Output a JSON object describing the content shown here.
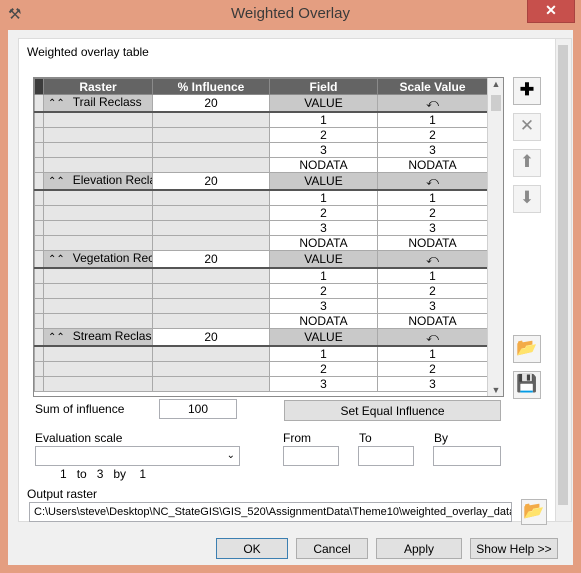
{
  "window": {
    "title": "Weighted Overlay",
    "close_label": "✕"
  },
  "table_label": "Weighted overlay table",
  "columns": [
    "Raster",
    "% Influence",
    "Field",
    "Scale Value"
  ],
  "groups": [
    {
      "raster": "Trail Reclass",
      "influence": "20",
      "field": "VALUE",
      "rows": [
        {
          "field": "1",
          "scale": "1"
        },
        {
          "field": "2",
          "scale": "2"
        },
        {
          "field": "3",
          "scale": "3"
        },
        {
          "field": "NODATA",
          "scale": "NODATA"
        }
      ]
    },
    {
      "raster": "Elevation Reclass",
      "influence": "20",
      "field": "VALUE",
      "rows": [
        {
          "field": "1",
          "scale": "1"
        },
        {
          "field": "2",
          "scale": "2"
        },
        {
          "field": "3",
          "scale": "3"
        },
        {
          "field": "NODATA",
          "scale": "NODATA"
        }
      ]
    },
    {
      "raster": "Vegetation Reclass",
      "influence": "20",
      "field": "VALUE",
      "rows": [
        {
          "field": "1",
          "scale": "1"
        },
        {
          "field": "2",
          "scale": "2"
        },
        {
          "field": "3",
          "scale": "3"
        },
        {
          "field": "NODATA",
          "scale": "NODATA"
        }
      ]
    },
    {
      "raster": "Stream Reclass",
      "influence": "20",
      "field": "VALUE",
      "rows": [
        {
          "field": "1",
          "scale": "1"
        },
        {
          "field": "2",
          "scale": "2"
        },
        {
          "field": "3",
          "scale": "3"
        }
      ]
    }
  ],
  "sum_label": "Sum of influence",
  "sum_value": "100",
  "set_equal_label": "Set Equal Influence",
  "eval_label": "Evaluation scale",
  "eval_value": "1   to   3   by    1",
  "from_label": "From",
  "to_label": "To",
  "by_label": "By",
  "output_label": "Output raster",
  "output_path": "C:\\Users\\steve\\Desktop\\NC_StateGIS\\GIS_520\\AssignmentData\\Theme10\\weighted_overlay_data",
  "buttons": {
    "ok": "OK",
    "cancel": "Cancel",
    "apply": "Apply",
    "help": "Show Help >>"
  },
  "icons": {
    "add": "plus-icon",
    "remove": "x-icon",
    "up": "arrow-up-icon",
    "down": "arrow-down-icon",
    "open": "folder-open-icon",
    "save": "save-icon"
  }
}
